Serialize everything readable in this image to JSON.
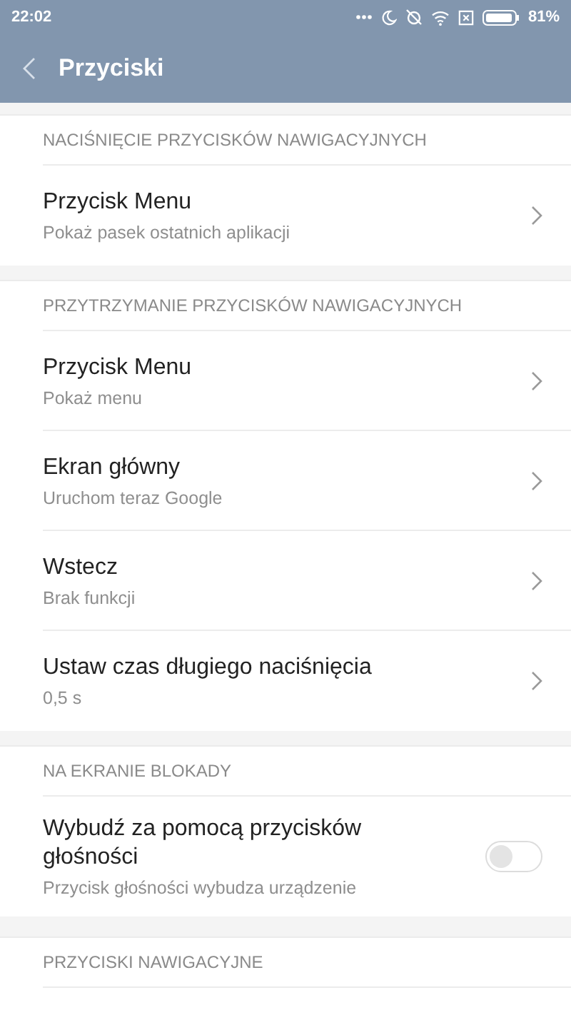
{
  "status_bar": {
    "time": "22:02",
    "battery": "81%"
  },
  "app_bar": {
    "title": "Przyciski"
  },
  "sections": [
    {
      "header": "NACIŚNIĘCIE PRZYCISKÓW NAWIGACYJNYCH",
      "items": [
        {
          "kind": "link",
          "title": "Przycisk Menu",
          "subtitle": "Pokaż pasek ostatnich aplikacji"
        }
      ]
    },
    {
      "header": "PRZYTRZYMANIE PRZYCISKÓW NAWIGACYJNYCH",
      "items": [
        {
          "kind": "link",
          "title": "Przycisk Menu",
          "subtitle": "Pokaż menu"
        },
        {
          "kind": "link",
          "title": "Ekran główny",
          "subtitle": "Uruchom teraz Google"
        },
        {
          "kind": "link",
          "title": "Wstecz",
          "subtitle": "Brak funkcji"
        },
        {
          "kind": "link",
          "title": "Ustaw czas długiego naciśnięcia",
          "subtitle": "0,5 s"
        }
      ]
    },
    {
      "header": "NA EKRANIE BLOKADY",
      "items": [
        {
          "kind": "toggle",
          "title": "Wybudź za pomocą przycisków głośności",
          "subtitle": "Przycisk głośności wybudza urządzenie",
          "on": false
        }
      ]
    },
    {
      "header": "PRZYCISKI NAWIGACYJNE"
    }
  ]
}
